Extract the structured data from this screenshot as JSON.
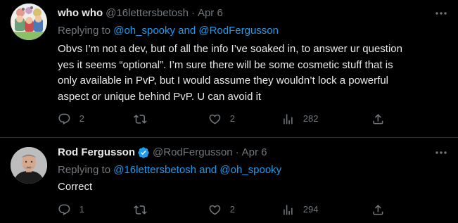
{
  "tweets": [
    {
      "author_name": "who who",
      "handle": "@16lettersbetosh",
      "separator": "·",
      "date": "Apr 6",
      "reply_prefix": "Replying to ",
      "reply_mention_1": "@oh_spooky",
      "reply_and": " and ",
      "reply_mention_2": "@RodFergusson",
      "text": "Obvs I’m not a dev, but of all the info I’ve soaked in, to answer ur question\nyes it seems “optional”. I’m sure there will be some cosmetic stuff that is\nonly available in PvP, but I would assume they wouldn’t lock a powerful\naspect or unique behind PvP. U can avoid it",
      "reply_count": "2",
      "retweet_count": "",
      "like_count": "2",
      "view_count": "282",
      "verified": false
    },
    {
      "author_name": "Rod Fergusson",
      "handle": "@RodFergusson",
      "separator": "·",
      "date": "Apr 6",
      "reply_prefix": "Replying to ",
      "reply_mention_1": "@16lettersbetosh",
      "reply_and": " and ",
      "reply_mention_2": "@oh_spooky",
      "text": "Correct",
      "reply_count": "1",
      "retweet_count": "",
      "like_count": "2",
      "view_count": "294",
      "verified": true
    }
  ],
  "colors": {
    "background": "#000000",
    "primary_text": "#e7e9ea",
    "secondary_text": "#71767b",
    "link": "#1d9bf0",
    "divider": "#2f3336"
  },
  "icons": {
    "reply": "reply-icon",
    "retweet": "retweet-icon",
    "like": "like-icon",
    "views": "views-icon",
    "share": "share-icon",
    "more": "more-icon",
    "verified": "verified-badge-icon"
  }
}
